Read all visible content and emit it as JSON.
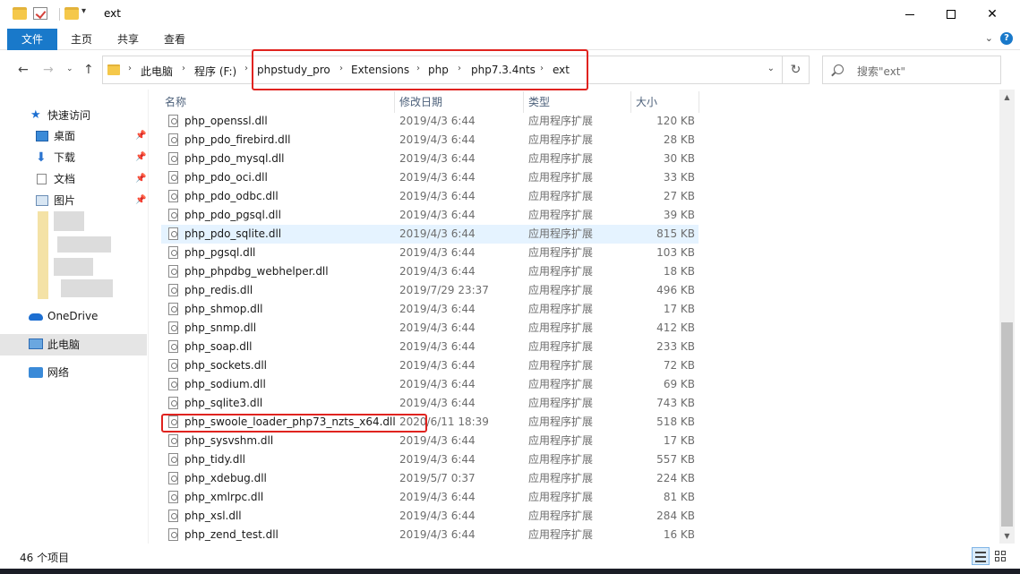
{
  "window": {
    "title": "ext",
    "minimize_label": "—",
    "maximize_label": "□",
    "close_label": "✕"
  },
  "ribbon": {
    "tabs": [
      "文件",
      "主页",
      "共享",
      "查看"
    ],
    "expand_glyph": "⌄",
    "help_glyph": "?"
  },
  "address": {
    "crumbs": [
      "此电脑",
      "程序 (F:)",
      "phpstudy_pro",
      "Extensions",
      "php",
      "php7.3.4nts",
      "ext"
    ],
    "separator": "›"
  },
  "search": {
    "placeholder": "搜索\"ext\""
  },
  "sidebar": {
    "quick_access": "快速访问",
    "items": [
      {
        "label": "桌面",
        "icon": "desktop-icon"
      },
      {
        "label": "下载",
        "icon": "download-icon"
      },
      {
        "label": "文档",
        "icon": "document-icon"
      },
      {
        "label": "图片",
        "icon": "pictures-icon"
      }
    ],
    "onedrive": "OneDrive",
    "this_pc": "此电脑",
    "network": "网络"
  },
  "columns": {
    "name": "名称",
    "date": "修改日期",
    "type": "类型",
    "size": "大小"
  },
  "files": [
    {
      "name": "php_openssl.dll",
      "date": "2019/4/3 6:44",
      "type": "应用程序扩展",
      "size": "120 KB"
    },
    {
      "name": "php_pdo_firebird.dll",
      "date": "2019/4/3 6:44",
      "type": "应用程序扩展",
      "size": "28 KB"
    },
    {
      "name": "php_pdo_mysql.dll",
      "date": "2019/4/3 6:44",
      "type": "应用程序扩展",
      "size": "30 KB"
    },
    {
      "name": "php_pdo_oci.dll",
      "date": "2019/4/3 6:44",
      "type": "应用程序扩展",
      "size": "33 KB"
    },
    {
      "name": "php_pdo_odbc.dll",
      "date": "2019/4/3 6:44",
      "type": "应用程序扩展",
      "size": "27 KB"
    },
    {
      "name": "php_pdo_pgsql.dll",
      "date": "2019/4/3 6:44",
      "type": "应用程序扩展",
      "size": "39 KB"
    },
    {
      "name": "php_pdo_sqlite.dll",
      "date": "2019/4/3 6:44",
      "type": "应用程序扩展",
      "size": "815 KB"
    },
    {
      "name": "php_pgsql.dll",
      "date": "2019/4/3 6:44",
      "type": "应用程序扩展",
      "size": "103 KB"
    },
    {
      "name": "php_phpdbg_webhelper.dll",
      "date": "2019/4/3 6:44",
      "type": "应用程序扩展",
      "size": "18 KB"
    },
    {
      "name": "php_redis.dll",
      "date": "2019/7/29 23:37",
      "type": "应用程序扩展",
      "size": "496 KB"
    },
    {
      "name": "php_shmop.dll",
      "date": "2019/4/3 6:44",
      "type": "应用程序扩展",
      "size": "17 KB"
    },
    {
      "name": "php_snmp.dll",
      "date": "2019/4/3 6:44",
      "type": "应用程序扩展",
      "size": "412 KB"
    },
    {
      "name": "php_soap.dll",
      "date": "2019/4/3 6:44",
      "type": "应用程序扩展",
      "size": "233 KB"
    },
    {
      "name": "php_sockets.dll",
      "date": "2019/4/3 6:44",
      "type": "应用程序扩展",
      "size": "72 KB"
    },
    {
      "name": "php_sodium.dll",
      "date": "2019/4/3 6:44",
      "type": "应用程序扩展",
      "size": "69 KB"
    },
    {
      "name": "php_sqlite3.dll",
      "date": "2019/4/3 6:44",
      "type": "应用程序扩展",
      "size": "743 KB"
    },
    {
      "name": "php_swoole_loader_php73_nzts_x64.dll",
      "date": "2020/6/11 18:39",
      "type": "应用程序扩展",
      "size": "518 KB"
    },
    {
      "name": "php_sysvshm.dll",
      "date": "2019/4/3 6:44",
      "type": "应用程序扩展",
      "size": "17 KB"
    },
    {
      "name": "php_tidy.dll",
      "date": "2019/4/3 6:44",
      "type": "应用程序扩展",
      "size": "557 KB"
    },
    {
      "name": "php_xdebug.dll",
      "date": "2019/5/7 0:37",
      "type": "应用程序扩展",
      "size": "224 KB"
    },
    {
      "name": "php_xmlrpc.dll",
      "date": "2019/4/3 6:44",
      "type": "应用程序扩展",
      "size": "81 KB"
    },
    {
      "name": "php_xsl.dll",
      "date": "2019/4/3 6:44",
      "type": "应用程序扩展",
      "size": "284 KB"
    },
    {
      "name": "php_zend_test.dll",
      "date": "2019/4/3 6:44",
      "type": "应用程序扩展",
      "size": "16 KB"
    }
  ],
  "status": {
    "count": "46 个项目"
  },
  "colors": {
    "accent": "#1979ca",
    "highlight_box": "#e0231f",
    "hover_row": "#e5f3ff"
  }
}
